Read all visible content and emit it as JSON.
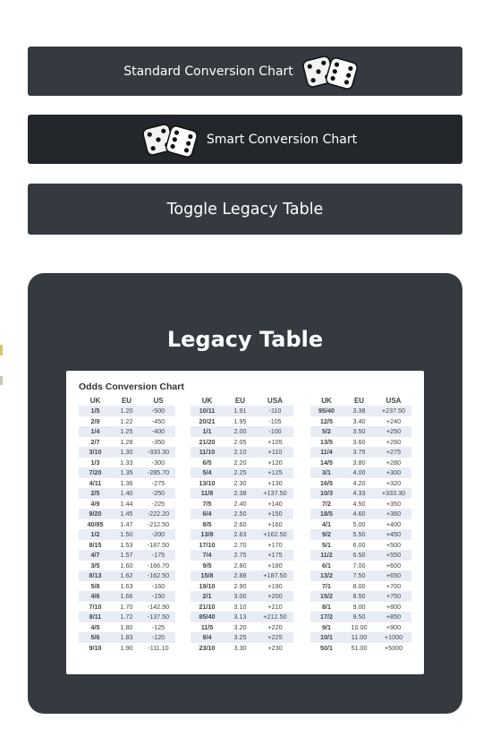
{
  "buttons": {
    "standard": "Standard Conversion Chart",
    "smart": "Smart Conversion Chart",
    "toggle": "Toggle Legacy Table"
  },
  "panel": {
    "title": "Legacy Table",
    "chart_title": "Odds Conversion Chart"
  },
  "groups": [
    {
      "headers": [
        "UK",
        "EU",
        "US"
      ],
      "rows": [
        [
          "1/5",
          "1.20",
          "-500"
        ],
        [
          "2/9",
          "1.22",
          "-450"
        ],
        [
          "1/4",
          "1.25",
          "-400"
        ],
        [
          "2/7",
          "1.28",
          "-350"
        ],
        [
          "3/10",
          "1.30",
          "-333.30"
        ],
        [
          "1/3",
          "1.33",
          "-300"
        ],
        [
          "7/20",
          "1.35",
          "-285.70"
        ],
        [
          "4/11",
          "1.36",
          "-275"
        ],
        [
          "2/5",
          "1.40",
          "-250"
        ],
        [
          "4/9",
          "1.44",
          "-225"
        ],
        [
          "9/20",
          "1.45",
          "-222.20"
        ],
        [
          "40/85",
          "1.47",
          "-212.50"
        ],
        [
          "1/2",
          "1.50",
          "-200"
        ],
        [
          "8/15",
          "1.53",
          "-187.50"
        ],
        [
          "4/7",
          "1.57",
          "-175"
        ],
        [
          "3/5",
          "1.60",
          "-166.70"
        ],
        [
          "8/13",
          "1.62",
          "-162.50"
        ],
        [
          "5/8",
          "1.63",
          "-160"
        ],
        [
          "4/6",
          "1.66",
          "-150"
        ],
        [
          "7/10",
          "1.70",
          "-142.90"
        ],
        [
          "8/11",
          "1.72",
          "-137.50"
        ],
        [
          "4/5",
          "1.80",
          "-125"
        ],
        [
          "5/6",
          "1.83",
          "-120"
        ],
        [
          "9/10",
          "1.90",
          "-111.10"
        ]
      ]
    },
    {
      "headers": [
        "UK",
        "EU",
        "USA"
      ],
      "rows": [
        [
          "10/11",
          "1.91",
          "-110"
        ],
        [
          "20/21",
          "1.95",
          "-105"
        ],
        [
          "1/1",
          "2.00",
          "-100"
        ],
        [
          "21/20",
          "2.05",
          "+105"
        ],
        [
          "11/10",
          "2.10",
          "+110"
        ],
        [
          "6/5",
          "2.20",
          "+120"
        ],
        [
          "5/4",
          "2.25",
          "+125"
        ],
        [
          "13/10",
          "2.30",
          "+130"
        ],
        [
          "11/8",
          "2.38",
          "+137.50"
        ],
        [
          "7/5",
          "2.40",
          "+140"
        ],
        [
          "6/4",
          "2.50",
          "+150"
        ],
        [
          "8/5",
          "2.60",
          "+160"
        ],
        [
          "13/8",
          "2.63",
          "+162.50"
        ],
        [
          "17/10",
          "2.70",
          "+170"
        ],
        [
          "7/4",
          "2.75",
          "+175"
        ],
        [
          "9/5",
          "2.80",
          "+180"
        ],
        [
          "15/8",
          "2.88",
          "+187.50"
        ],
        [
          "19/10",
          "2.90",
          "+190"
        ],
        [
          "2/1",
          "3.00",
          "+200"
        ],
        [
          "21/10",
          "3.10",
          "+210"
        ],
        [
          "85/40",
          "3.13",
          "+212.50"
        ],
        [
          "11/5",
          "3.20",
          "+220"
        ],
        [
          "9/4",
          "3.25",
          "+225"
        ],
        [
          "23/10",
          "3.30",
          "+230"
        ]
      ]
    },
    {
      "headers": [
        "UK",
        "EU",
        "USA"
      ],
      "rows": [
        [
          "95/40",
          "3.38",
          "+237.50"
        ],
        [
          "12/5",
          "3.40",
          "+240"
        ],
        [
          "5/2",
          "3.50",
          "+250"
        ],
        [
          "13/5",
          "3.60",
          "+260"
        ],
        [
          "11/4",
          "3.75",
          "+275"
        ],
        [
          "14/5",
          "3.80",
          "+280"
        ],
        [
          "3/1",
          "4.00",
          "+300"
        ],
        [
          "16/5",
          "4.20",
          "+320"
        ],
        [
          "10/3",
          "4.33",
          "+333.30"
        ],
        [
          "7/2",
          "4.50",
          "+350"
        ],
        [
          "18/5",
          "4.60",
          "+360"
        ],
        [
          "4/1",
          "5.00",
          "+400"
        ],
        [
          "9/2",
          "5.50",
          "+450"
        ],
        [
          "5/1",
          "6.00",
          "+500"
        ],
        [
          "11/2",
          "6.50",
          "+550"
        ],
        [
          "6/1",
          "7.00",
          "+600"
        ],
        [
          "13/2",
          "7.50",
          "+650"
        ],
        [
          "7/1",
          "8.00",
          "+700"
        ],
        [
          "15/2",
          "8.50",
          "+750"
        ],
        [
          "8/1",
          "9.00",
          "+800"
        ],
        [
          "17/2",
          "9.50",
          "+850"
        ],
        [
          "9/1",
          "10.00",
          "+900"
        ],
        [
          "10/1",
          "11.00",
          "+1000"
        ],
        [
          "50/1",
          "51.00",
          "+5000"
        ]
      ]
    }
  ],
  "icons": {
    "dice": "dice-icon"
  },
  "colors": {
    "button_dark": "#343a40",
    "button_darker": "#23272b",
    "panel": "#343a40"
  }
}
